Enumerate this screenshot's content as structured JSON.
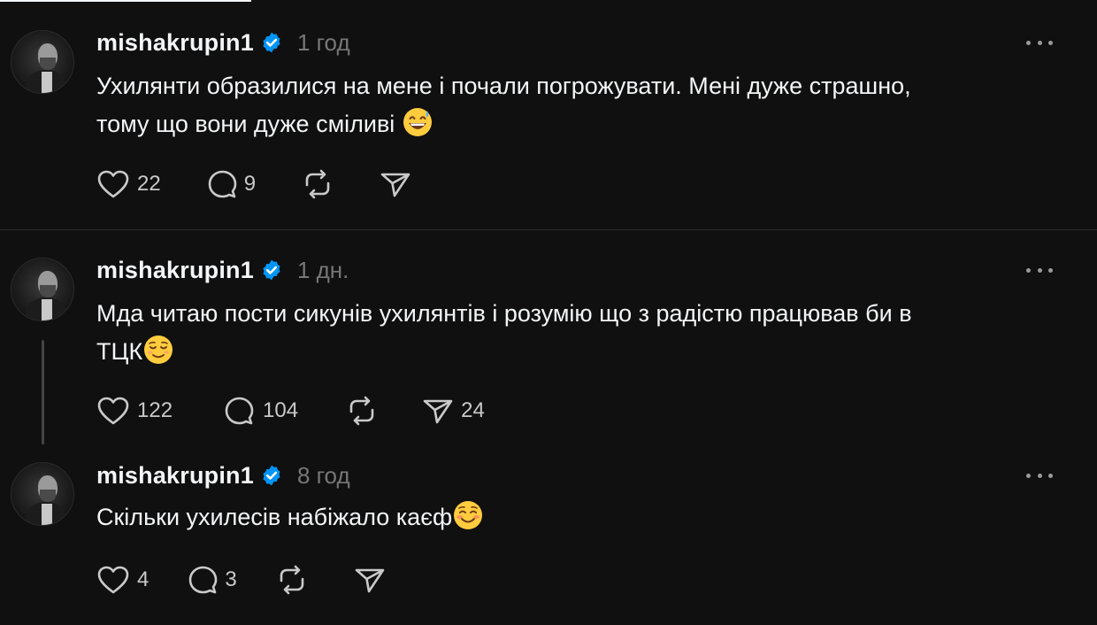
{
  "posts": [
    {
      "username": "mishakrupin1",
      "time": "1 год",
      "text_line1": "Ухилянти образилися на мене і почали погрожувати. Мені дуже страшно,",
      "text_line2": "тому що вони дуже сміливі",
      "emoji": "grinning-sweat-emoji",
      "likes": "22",
      "replies": "9",
      "reposts": "",
      "shares": ""
    },
    {
      "username": "mishakrupin1",
      "time": "1 дн.",
      "text_line1": "Мда читаю пости сикунів ухилянтів і розумію що з радістю працював би в",
      "text_line2": "ТЦК",
      "emoji": "relieved-emoji",
      "likes": "122",
      "replies": "104",
      "reposts": "",
      "shares": "24"
    },
    {
      "username": "mishakrupin1",
      "time": "8 год",
      "text_line1": "Скільки ухилесів набіжало каєф",
      "emoji": "smiling-blush-emoji",
      "likes": "4",
      "replies": "3",
      "reposts": "",
      "shares": ""
    }
  ],
  "colors": {
    "background": "#101010",
    "text": "#f3f5f7",
    "muted": "#777777",
    "verified": "#0095f6",
    "divider": "#2d2d2d"
  },
  "icons": [
    "heart-icon",
    "comment-icon",
    "repost-icon",
    "share-icon",
    "verified-badge-icon",
    "more-icon"
  ]
}
